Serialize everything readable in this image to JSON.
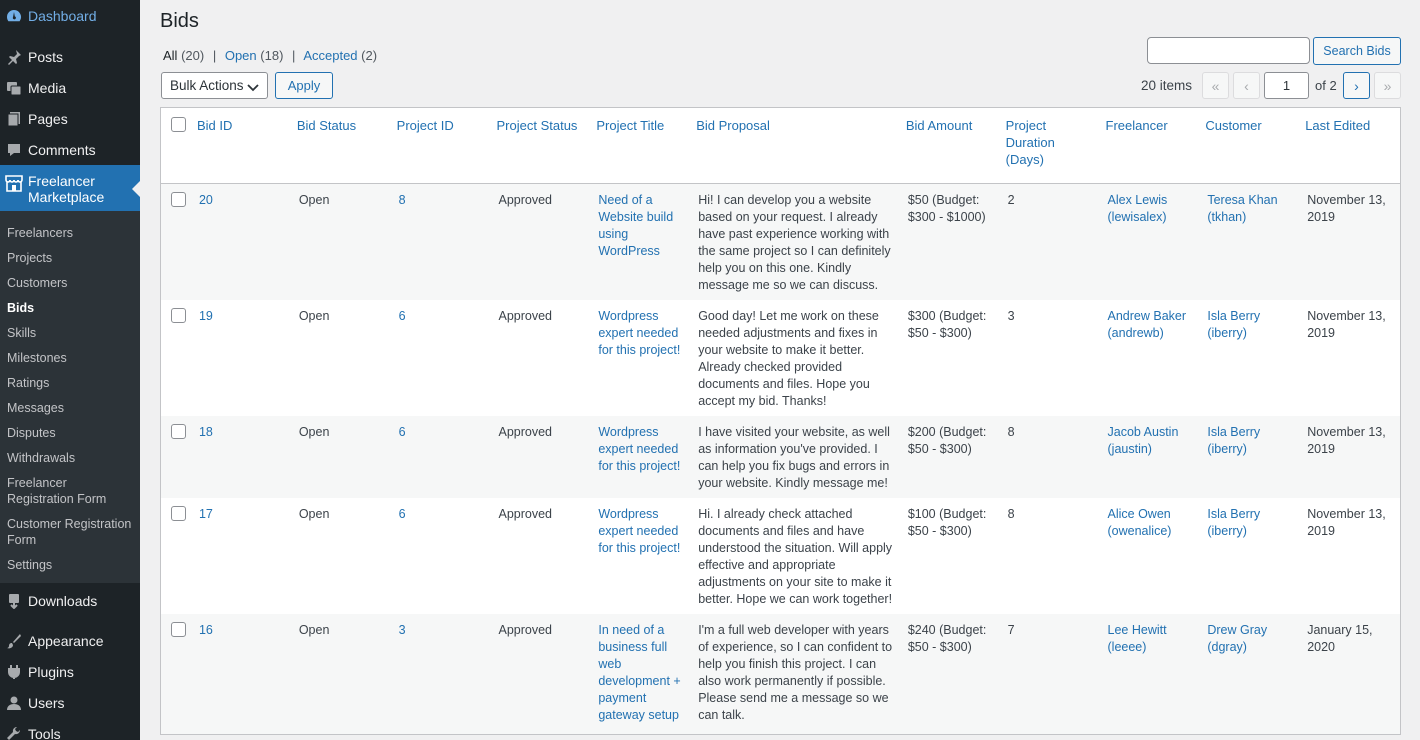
{
  "sidebar": {
    "dashboard": "Dashboard",
    "posts": "Posts",
    "media": "Media",
    "pages": "Pages",
    "comments": "Comments",
    "freelancer_marketplace": "Freelancer Marketplace",
    "submenu": [
      "Freelancers",
      "Projects",
      "Customers",
      "Bids",
      "Skills",
      "Milestones",
      "Ratings",
      "Messages",
      "Disputes",
      "Withdrawals",
      "Freelancer Registration Form",
      "Customer Registration Form",
      "Settings"
    ],
    "downloads": "Downloads",
    "appearance": "Appearance",
    "plugins": "Plugins",
    "users": "Users",
    "tools": "Tools"
  },
  "page": {
    "title": "Bids",
    "filters": {
      "all": "All",
      "all_count": "(20)",
      "open": "Open",
      "open_count": "(18)",
      "accepted": "Accepted",
      "accepted_count": "(2)",
      "separator": "|"
    },
    "search_button": "Search Bids",
    "search_value": "",
    "bulk_actions": "Bulk Actions",
    "apply": "Apply",
    "items": "20 items",
    "pagination": {
      "first": "«",
      "prev": "‹",
      "current": "1",
      "of": "of 2",
      "next": "›",
      "last": "»"
    }
  },
  "table": {
    "headers": {
      "bid_id": "Bid ID",
      "bid_status": "Bid Status",
      "project_id": "Project ID",
      "project_status": "Project Status",
      "project_title": "Project Title",
      "bid_proposal": "Bid Proposal",
      "bid_amount": "Bid Amount",
      "project_duration": "Project Duration (Days)",
      "freelancer": "Freelancer",
      "customer": "Customer",
      "last_edited": "Last Edited"
    },
    "rows": [
      {
        "bid_id": "20",
        "bid_status": "Open",
        "project_id": "8",
        "project_status": "Approved",
        "project_title": "Need of a Website build using WordPress",
        "proposal": "Hi! I can develop you a website based on your request. I already have past experience working with the same project so I can definitely help you on this one. Kindly message me so we can discuss.",
        "amount": "$50 (Budget: $300 - $1000)",
        "duration": "2",
        "freelancer": "Alex Lewis (lewisalex)",
        "customer": "Teresa Khan (tkhan)",
        "edited": "November 13, 2019"
      },
      {
        "bid_id": "19",
        "bid_status": "Open",
        "project_id": "6",
        "project_status": "Approved",
        "project_title": "Wordpress expert needed for this project!",
        "proposal": "Good day! Let me work on these needed adjustments and fixes in your website to make it better. Already checked provided documents and files. Hope you accept my bid. Thanks!",
        "amount": "$300 (Budget: $50 - $300)",
        "duration": "3",
        "freelancer": "Andrew Baker (andrewb)",
        "customer": "Isla Berry (iberry)",
        "edited": "November 13, 2019"
      },
      {
        "bid_id": "18",
        "bid_status": "Open",
        "project_id": "6",
        "project_status": "Approved",
        "project_title": "Wordpress expert needed for this project!",
        "proposal": "I have visited your website, as well as information you've provided. I can help you fix bugs and errors in your website. Kindly message me!",
        "amount": "$200 (Budget: $50 - $300)",
        "duration": "8",
        "freelancer": "Jacob Austin (jaustin)",
        "customer": "Isla Berry (iberry)",
        "edited": "November 13, 2019"
      },
      {
        "bid_id": "17",
        "bid_status": "Open",
        "project_id": "6",
        "project_status": "Approved",
        "project_title": "Wordpress expert needed for this project!",
        "proposal": "Hi. I already check attached documents and files and have understood the situation. Will apply effective and appropriate adjustments on your site to make it better. Hope we can work together!",
        "amount": "$100 (Budget: $50 - $300)",
        "duration": "8",
        "freelancer": "Alice Owen (owenalice)",
        "customer": "Isla Berry (iberry)",
        "edited": "November 13, 2019"
      },
      {
        "bid_id": "16",
        "bid_status": "Open",
        "project_id": "3",
        "project_status": "Approved",
        "project_title": "In need of a business full web development + payment gateway setup",
        "proposal": "I'm a full web developer with years of experience, so I can confident to help you finish this project. I can also work permanently if possible. Please send me a message so we can talk.",
        "amount": "$240 (Budget: $50 - $300)",
        "duration": "7",
        "freelancer": "Lee Hewitt (leeee)",
        "customer": "Drew Gray (dgray)",
        "edited": "January 15, 2020"
      }
    ]
  }
}
